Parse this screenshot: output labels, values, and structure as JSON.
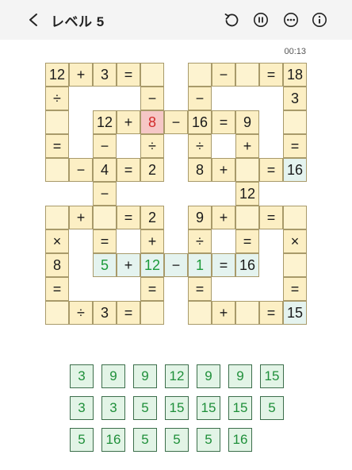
{
  "header": {
    "title": "レベル 5"
  },
  "timer": "00:13",
  "colors": {
    "cell": "#fcefc4",
    "selected": "#f6c7c6",
    "placed_text": "#1c9a3a",
    "placed_bg": "#e4f3ef",
    "tile": "#e2f4e6"
  },
  "grid": [
    {
      "r": 0,
      "c": 0,
      "t": "12"
    },
    {
      "r": 0,
      "c": 1,
      "t": "+"
    },
    {
      "r": 0,
      "c": 2,
      "t": "3"
    },
    {
      "r": 0,
      "c": 3,
      "t": "="
    },
    {
      "r": 0,
      "c": 4,
      "t": ""
    },
    {
      "r": 0,
      "c": 6,
      "t": ""
    },
    {
      "r": 0,
      "c": 7,
      "t": "−"
    },
    {
      "r": 0,
      "c": 8,
      "t": ""
    },
    {
      "r": 0,
      "c": 9,
      "t": "="
    },
    {
      "r": 0,
      "c": 10,
      "t": "18"
    },
    {
      "r": 1,
      "c": 0,
      "t": "÷"
    },
    {
      "r": 1,
      "c": 4,
      "t": "−"
    },
    {
      "r": 1,
      "c": 6,
      "t": "−"
    },
    {
      "r": 1,
      "c": 10,
      "t": "3"
    },
    {
      "r": 2,
      "c": 0,
      "t": ""
    },
    {
      "r": 2,
      "c": 2,
      "t": "12"
    },
    {
      "r": 2,
      "c": 3,
      "t": "+"
    },
    {
      "r": 2,
      "c": 4,
      "t": "8",
      "s": "sel"
    },
    {
      "r": 2,
      "c": 5,
      "t": "−"
    },
    {
      "r": 2,
      "c": 6,
      "t": "16"
    },
    {
      "r": 2,
      "c": 7,
      "t": "="
    },
    {
      "r": 2,
      "c": 8,
      "t": "9"
    },
    {
      "r": 2,
      "c": 10,
      "t": ""
    },
    {
      "r": 3,
      "c": 0,
      "t": "="
    },
    {
      "r": 3,
      "c": 2,
      "t": "−"
    },
    {
      "r": 3,
      "c": 4,
      "t": "÷"
    },
    {
      "r": 3,
      "c": 6,
      "t": "÷"
    },
    {
      "r": 3,
      "c": 8,
      "t": "+"
    },
    {
      "r": 3,
      "c": 10,
      "t": "="
    },
    {
      "r": 4,
      "c": 0,
      "t": ""
    },
    {
      "r": 4,
      "c": 1,
      "t": "−"
    },
    {
      "r": 4,
      "c": 2,
      "t": "4"
    },
    {
      "r": 4,
      "c": 3,
      "t": "="
    },
    {
      "r": 4,
      "c": 4,
      "t": "2"
    },
    {
      "r": 4,
      "c": 6,
      "t": "8"
    },
    {
      "r": 4,
      "c": 7,
      "t": "+"
    },
    {
      "r": 4,
      "c": 8,
      "t": ""
    },
    {
      "r": 4,
      "c": 9,
      "t": "="
    },
    {
      "r": 4,
      "c": 10,
      "t": "16",
      "s": "teal"
    },
    {
      "r": 5,
      "c": 2,
      "t": "−"
    },
    {
      "r": 5,
      "c": 8,
      "t": "12"
    },
    {
      "r": 6,
      "c": 0,
      "t": ""
    },
    {
      "r": 6,
      "c": 1,
      "t": "+"
    },
    {
      "r": 6,
      "c": 2,
      "t": ""
    },
    {
      "r": 6,
      "c": 3,
      "t": "="
    },
    {
      "r": 6,
      "c": 4,
      "t": "2"
    },
    {
      "r": 6,
      "c": 6,
      "t": "9"
    },
    {
      "r": 6,
      "c": 7,
      "t": "+"
    },
    {
      "r": 6,
      "c": 8,
      "t": ""
    },
    {
      "r": 6,
      "c": 9,
      "t": "="
    },
    {
      "r": 6,
      "c": 10,
      "t": ""
    },
    {
      "r": 7,
      "c": 0,
      "t": "×"
    },
    {
      "r": 7,
      "c": 2,
      "t": "="
    },
    {
      "r": 7,
      "c": 4,
      "t": "+"
    },
    {
      "r": 7,
      "c": 6,
      "t": "÷"
    },
    {
      "r": 7,
      "c": 8,
      "t": "="
    },
    {
      "r": 7,
      "c": 10,
      "t": "×"
    },
    {
      "r": 8,
      "c": 0,
      "t": "8"
    },
    {
      "r": 8,
      "c": 2,
      "t": "5",
      "s": "green"
    },
    {
      "r": 8,
      "c": 3,
      "t": "+",
      "s": "teal"
    },
    {
      "r": 8,
      "c": 4,
      "t": "12",
      "s": "green"
    },
    {
      "r": 8,
      "c": 5,
      "t": "−",
      "s": "teal"
    },
    {
      "r": 8,
      "c": 6,
      "t": "1",
      "s": "green"
    },
    {
      "r": 8,
      "c": 7,
      "t": "=",
      "s": "teal"
    },
    {
      "r": 8,
      "c": 8,
      "t": "16",
      "s": "teal"
    },
    {
      "r": 8,
      "c": 10,
      "t": ""
    },
    {
      "r": 9,
      "c": 0,
      "t": "="
    },
    {
      "r": 9,
      "c": 4,
      "t": "="
    },
    {
      "r": 9,
      "c": 6,
      "t": "="
    },
    {
      "r": 9,
      "c": 10,
      "t": "="
    },
    {
      "r": 10,
      "c": 0,
      "t": ""
    },
    {
      "r": 10,
      "c": 1,
      "t": "÷"
    },
    {
      "r": 10,
      "c": 2,
      "t": "3"
    },
    {
      "r": 10,
      "c": 3,
      "t": "="
    },
    {
      "r": 10,
      "c": 4,
      "t": ""
    },
    {
      "r": 10,
      "c": 6,
      "t": ""
    },
    {
      "r": 10,
      "c": 7,
      "t": "+"
    },
    {
      "r": 10,
      "c": 8,
      "t": ""
    },
    {
      "r": 10,
      "c": 9,
      "t": "="
    },
    {
      "r": 10,
      "c": 10,
      "t": "15",
      "s": "teal"
    }
  ],
  "tiles": [
    [
      "3",
      "9",
      "9",
      "12",
      "9",
      "9",
      "15"
    ],
    [
      "3",
      "3",
      "5",
      "15",
      "15",
      "15",
      "5"
    ],
    [
      "5",
      "16",
      "5",
      "5",
      "5",
      "16"
    ]
  ]
}
